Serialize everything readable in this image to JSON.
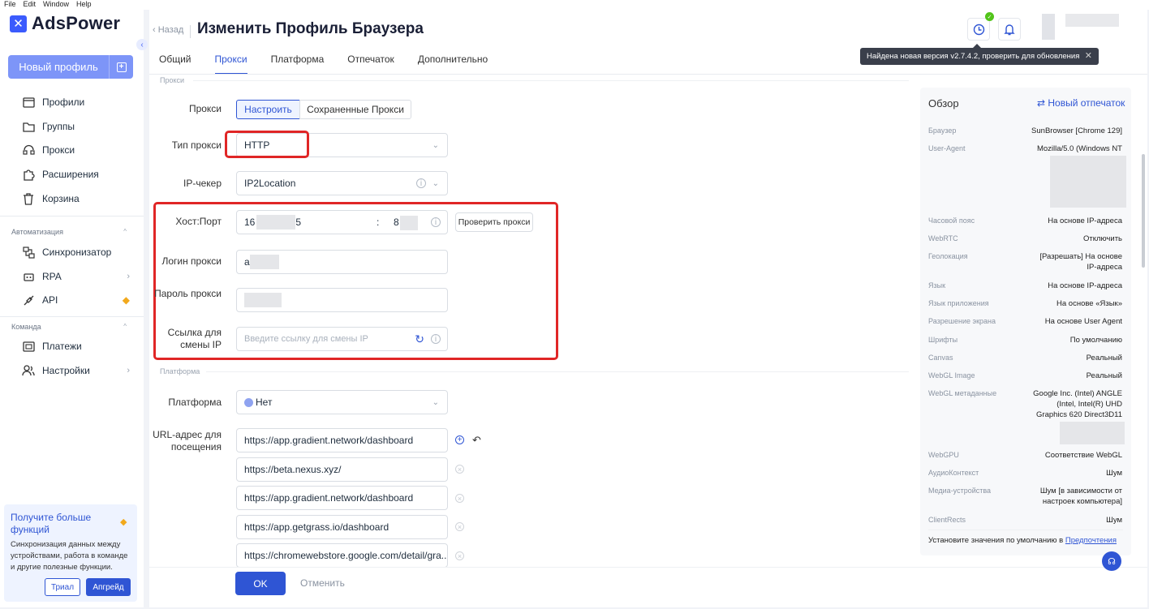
{
  "os_menu": [
    "File",
    "Edit",
    "Window",
    "Help"
  ],
  "app": {
    "logo_text": "AdsPower",
    "new_profile": "Новый профиль"
  },
  "sidebar": {
    "items": [
      {
        "label": "Профили",
        "icon": "folder-icon"
      },
      {
        "label": "Группы",
        "icon": "folder-icon"
      },
      {
        "label": "Прокси",
        "icon": "proxy-icon"
      },
      {
        "label": "Расширения",
        "icon": "puzzle-icon"
      },
      {
        "label": "Корзина",
        "icon": "trash-icon"
      }
    ],
    "automation_title": "Автоматизация",
    "automation_items": [
      {
        "label": "Синхронизатор",
        "icon": "sync-icon"
      },
      {
        "label": "RPA",
        "icon": "robot-icon"
      },
      {
        "label": "API",
        "icon": "api-icon"
      }
    ],
    "team_title": "Команда",
    "team_items": [
      {
        "label": "Платежи",
        "icon": "payment-icon"
      },
      {
        "label": "Настройки",
        "icon": "users-icon"
      }
    ]
  },
  "promo": {
    "title": "Получите больше функций",
    "description": "Синхронизация данных между устройствами, работа в команде и другие полезные функции.",
    "trial": "Триал",
    "upgrade": "Апгрейд"
  },
  "header": {
    "back": "Назад",
    "title": "Изменить Профиль Браузера",
    "tooltip": "Найдена новая версия v2.7.4.2, проверить для обновления"
  },
  "tabs": [
    "Общий",
    "Прокси",
    "Платформа",
    "Отпечаток",
    "Дополнительно"
  ],
  "active_tab": "Прокси",
  "proxy": {
    "section": "Прокси",
    "proxy_label": "Прокси",
    "btn_configure": "Настроить",
    "btn_saved": "Сохраненные Прокси",
    "type_label": "Тип прокси",
    "type_value": "HTTP",
    "ipchecker_label": "IP-чекер",
    "ipchecker_value": "IP2Location",
    "host_label": "Хост:Порт",
    "host_start": "16",
    "host_end": "5",
    "port_sep": ":",
    "port_start": "8",
    "check_btn": "Проверить прокси",
    "login_label": "Логин прокси",
    "login_start": "a",
    "password_label": "Пароль прокси",
    "refresh_label": "Ссылка для смены IP",
    "refresh_placeholder": "Введите ссылку для смены IP"
  },
  "platform": {
    "section": "Платформа",
    "platform_label": "Платформа",
    "platform_value": "Нет",
    "url_label": "URL-адрес для посещения",
    "urls": [
      "https://app.gradient.network/dashboard",
      "https://beta.nexus.xyz/",
      "https://app.gradient.network/dashboard",
      "https://app.getgrass.io/dashboard",
      "https://chromewebstore.google.com/detail/gra..."
    ]
  },
  "footer": {
    "ok": "OK",
    "cancel": "Отменить"
  },
  "overview": {
    "title": "Обзор",
    "new_fingerprint": "Новый отпечаток",
    "rows": [
      {
        "key": "Браузер",
        "value": "SunBrowser [Chrome 129]"
      },
      {
        "key": "User-Agent",
        "value": "Mozilla/5.0 (Windows NT"
      },
      {
        "key": "Часовой пояс",
        "value": "На основе IP-адреса"
      },
      {
        "key": "WebRTC",
        "value": "Отключить"
      },
      {
        "key": "Геолокация",
        "value": "[Разрешать] На основе IP-адреса"
      },
      {
        "key": "Язык",
        "value": "На основе IP-адреса"
      },
      {
        "key": "Язык приложения",
        "value": "На основе «Язык»"
      },
      {
        "key": "Разрешение экрана",
        "value": "На основе User Agent"
      },
      {
        "key": "Шрифты",
        "value": "По умолчанию"
      },
      {
        "key": "Canvas",
        "value": "Реальный"
      },
      {
        "key": "WebGL Image",
        "value": "Реальный"
      },
      {
        "key": "WebGL метаданные",
        "value": "Google Inc. (Intel) ANGLE (Intel, Intel(R) UHD Graphics 620 Direct3D11"
      },
      {
        "key": "WebGPU",
        "value": "Соответствие WebGL"
      },
      {
        "key": "АудиоКонтекст",
        "value": "Шум"
      },
      {
        "key": "Медиа-устройства",
        "value": "Шум [в зависимости от настроек компьютера]"
      },
      {
        "key": "ClientRects",
        "value": "Шум"
      }
    ],
    "footer_text": "Установите значения по умолчанию в",
    "footer_link": "Предпочтения"
  },
  "colors": {
    "accent": "#2f55d4",
    "highlight": "#e02626",
    "sidebar_button": "#7d95f8"
  }
}
